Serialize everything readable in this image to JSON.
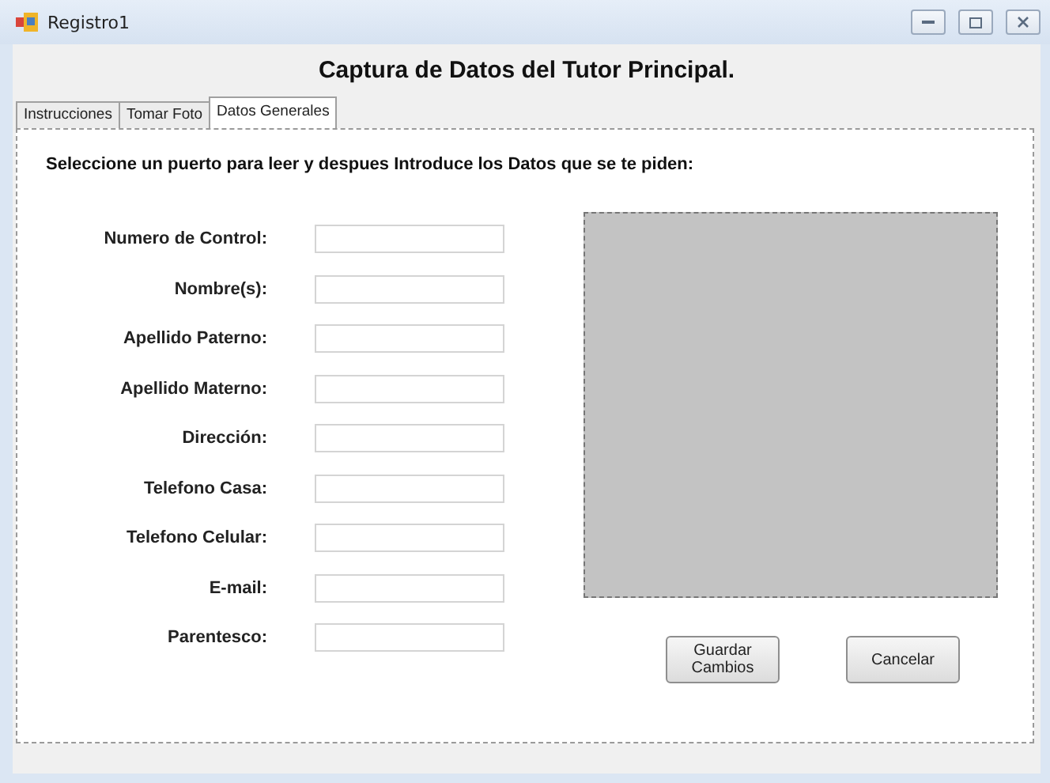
{
  "window": {
    "title": "Registro1"
  },
  "heading": "Captura de Datos del Tutor Principal.",
  "tabs": [
    {
      "label": "Instrucciones",
      "selected": false
    },
    {
      "label": "Tomar Foto",
      "selected": false
    },
    {
      "label": "Datos Generales",
      "selected": true
    }
  ],
  "instruction": "Seleccione un puerto para leer y despues Introduce los Datos que se te piden:",
  "fields": [
    {
      "label": "Numero de Control:"
    },
    {
      "label": "Nombre(s):"
    },
    {
      "label": "Apellido Paterno:"
    },
    {
      "label": "Apellido Materno:"
    },
    {
      "label": "Dirección:"
    },
    {
      "label": "Telefono Casa:"
    },
    {
      "label": "Telefono Celular:"
    },
    {
      "label": "E-mail:"
    },
    {
      "label": "Parentesco:"
    }
  ],
  "buttons": [
    "Guardar Cambios",
    "Cancelar"
  ]
}
